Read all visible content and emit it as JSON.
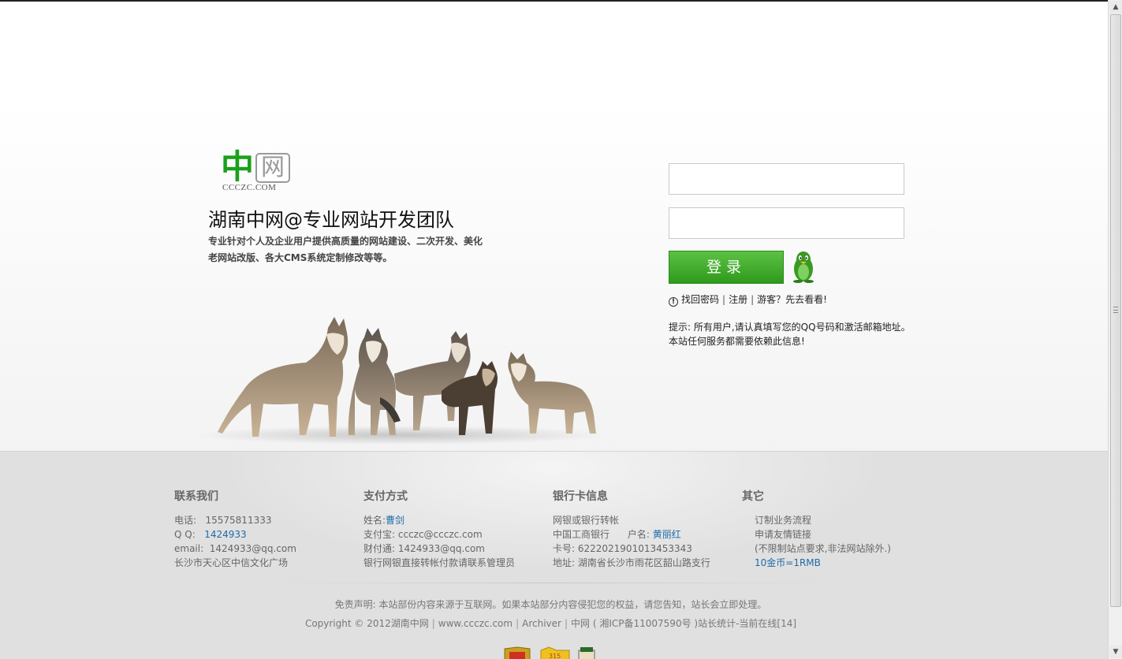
{
  "logo": {
    "main": "中",
    "secondary": "网",
    "subtitle": "CCCZC.COM"
  },
  "hero": {
    "headline": "湖南中网@专业网站开发团队",
    "description_line1": "专业针对个人及企业用户提供高质量的网站建设、二次开发、美化",
    "description_line2": "老网站改版、各大CMS系统定制修改等等。"
  },
  "login": {
    "username_value": "",
    "password_value": "",
    "login_label": "登录",
    "links": {
      "forgot": "找回密码",
      "register": "注册",
      "guest": "游客？先去看看!"
    },
    "tip_line1": "提示: 所有用户,请认真填写您的QQ号码和激活邮箱地址。",
    "tip_line2": "本站任何服务都需要依赖此信息!"
  },
  "footer": {
    "contact": {
      "title": "联系我们",
      "phone_label": "电话:",
      "phone": "15575811333",
      "qq_label": "Q Q:",
      "qq": "1424933",
      "email_label": "email:",
      "email": "1424933@qq.com",
      "address": "长沙市天心区中信文化广场"
    },
    "payment": {
      "title": "支付方式",
      "name_label": "姓名:",
      "name": "曹剑",
      "alipay": "支付宝: ccczc@ccczc.com",
      "tenpay": "财付通: 1424933@qq.com",
      "note": "银行网银直接转帐付款请联系管理员"
    },
    "bank": {
      "title": "银行卡信息",
      "line1": "网银或银行转帐",
      "bank_name": "中国工商银行",
      "holder_label": "户名:",
      "holder": "黄丽红",
      "card": "卡号: 6222021901013453343",
      "address": "地址: 湖南省长沙市雨花区韶山路支行"
    },
    "other": {
      "title": "其它",
      "line1": "订制业务流程",
      "line2": "申请友情链接",
      "line3": "(不限制站点要求,非法网站除外.)",
      "line4": "10金币=1RMB"
    },
    "disclaimer": "免责声明: 本站部份内容来源于互联网。如果本站部分内容侵犯您的权益，请您告知，站长会立即处理。",
    "copyright": "Copyright © 2012湖南中网",
    "site": "www.ccczc.com",
    "archiver": "Archiver",
    "icp": "中网 ( 湘ICP备11007590号 )站长统计-当前在线[14]"
  },
  "colors": {
    "accent_green": "#3aa62a",
    "link_blue": "#1e6ca8",
    "footer_bg": "#e0e0e0"
  }
}
